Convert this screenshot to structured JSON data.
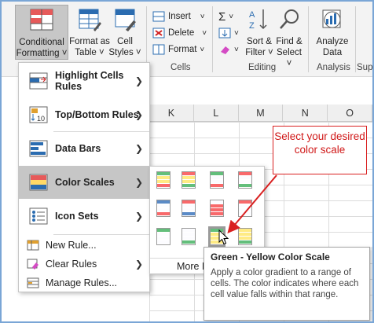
{
  "ribbon": {
    "conditional_formatting": [
      "Conditional",
      "Formatting ˅"
    ],
    "format_as_table": [
      "Format as",
      "Table ˅"
    ],
    "cell_styles": [
      "Cell",
      "Styles ˅"
    ],
    "insert": "Insert",
    "delete": "Delete",
    "format": "Format",
    "cells_group": "Cells",
    "sort_filter": [
      "Sort &",
      "Filter ˅"
    ],
    "find_select": [
      "Find &",
      "Select ˅"
    ],
    "editing_group": "Editing",
    "analyze_data": [
      "Analyze",
      "Data"
    ],
    "analysis_group": "Analysis",
    "sup_group": "Sup"
  },
  "columns": [
    "K",
    "L",
    "M",
    "N",
    "O"
  ],
  "menu": {
    "items": [
      {
        "label": "Highlight Cells Rules",
        "icon": "highlight-cells-icon"
      },
      {
        "label": "Top/Bottom Rules",
        "icon": "top-bottom-icon"
      },
      {
        "label": "Data Bars",
        "icon": "data-bars-icon"
      },
      {
        "label": "Color Scales",
        "icon": "color-scales-icon"
      },
      {
        "label": "Icon Sets",
        "icon": "icon-sets-icon"
      }
    ],
    "small_items": [
      {
        "label": "New Rule...",
        "icon": "new-rule-icon"
      },
      {
        "label": "Clear Rules",
        "icon": "clear-rules-icon"
      },
      {
        "label": "Manage Rules...",
        "icon": "manage-rules-icon"
      }
    ]
  },
  "submenu": {
    "scales": [
      [
        "#63be7b",
        "#ffeb84",
        "#f8696b"
      ],
      [
        "#f8696b",
        "#ffeb84",
        "#63be7b"
      ],
      [
        "#63be7b",
        "#fcfcff",
        "#f8696b"
      ],
      [
        "#f8696b",
        "#fcfcff",
        "#63be7b"
      ],
      [
        "#5a8ac6",
        "#fcfcff",
        "#f8696b"
      ],
      [
        "#f8696b",
        "#fcfcff",
        "#5a8ac6"
      ],
      [
        "#fcfcff",
        "#f8696b",
        "#f8696b"
      ],
      [
        "#f8696b",
        "#fcfcff",
        "#fcfcff"
      ],
      [
        "#63be7b",
        "#fcfcff",
        "#fcfcff"
      ],
      [
        "#fcfcff",
        "#fcfcff",
        "#63be7b"
      ],
      [
        "#63be7b",
        "#ffeb84",
        "#ffeb84"
      ],
      [
        "#ffeb84",
        "#ffeb84",
        "#63be7b"
      ]
    ],
    "selected_index": 10,
    "more_rules": "More Rules..."
  },
  "tooltip": {
    "title": "Green - Yellow Color Scale",
    "body": "Apply a color gradient to a range of cells. The color indicates where each cell value falls within that range."
  },
  "callout": {
    "text": "Select your desired color scale",
    "color": "#d01818"
  }
}
